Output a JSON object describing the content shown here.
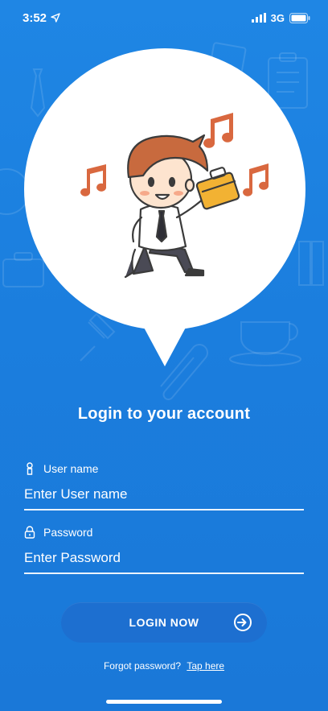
{
  "status_bar": {
    "time": "3:52",
    "network": "3G"
  },
  "form": {
    "title": "Login to your account",
    "username_label": "User name",
    "username_placeholder": "Enter User name",
    "password_label": "Password",
    "password_placeholder": "Enter Password"
  },
  "login_button": {
    "label": "LOGIN NOW"
  },
  "forgot": {
    "text": "Forgot password?",
    "link": "Tap here"
  },
  "icons": {
    "location": "location-arrow-icon",
    "signal": "signal-bars-icon",
    "battery": "battery-icon",
    "user": "person-icon",
    "lock": "lock-icon",
    "login": "sign-in-arrow-icon"
  },
  "colors": {
    "background": "#1b7ede",
    "button": "#1d6fd0",
    "note": "#d9683f",
    "briefcase": "#f2b233"
  }
}
